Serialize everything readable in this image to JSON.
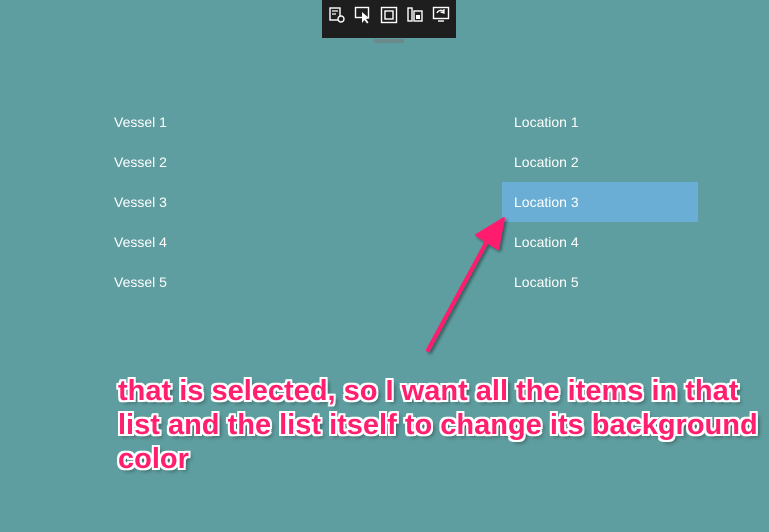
{
  "debug_toolbar": {
    "buttons": [
      {
        "icon": "live-visual-tree-icon"
      },
      {
        "icon": "select-element-icon"
      },
      {
        "icon": "display-layout-adorners-icon"
      },
      {
        "icon": "track-focus-icon"
      },
      {
        "icon": "hot-reload-icon"
      }
    ]
  },
  "vessels": {
    "items": [
      {
        "label": "Vessel 1"
      },
      {
        "label": "Vessel 2"
      },
      {
        "label": "Vessel 3"
      },
      {
        "label": "Vessel 4"
      },
      {
        "label": "Vessel 5"
      }
    ]
  },
  "locations": {
    "items": [
      {
        "label": "Location 1"
      },
      {
        "label": "Location 2"
      },
      {
        "label": "Location 3"
      },
      {
        "label": "Location 4"
      },
      {
        "label": "Location 5"
      }
    ],
    "selected_item": "Location 3",
    "selected_color": "#6aaed6"
  },
  "annotation": {
    "text": "that is selected, so I want all the items in that list and the list itself to change its background color",
    "color": "#ff1f6e"
  },
  "colors": {
    "window_background": "#5f9ea0"
  }
}
